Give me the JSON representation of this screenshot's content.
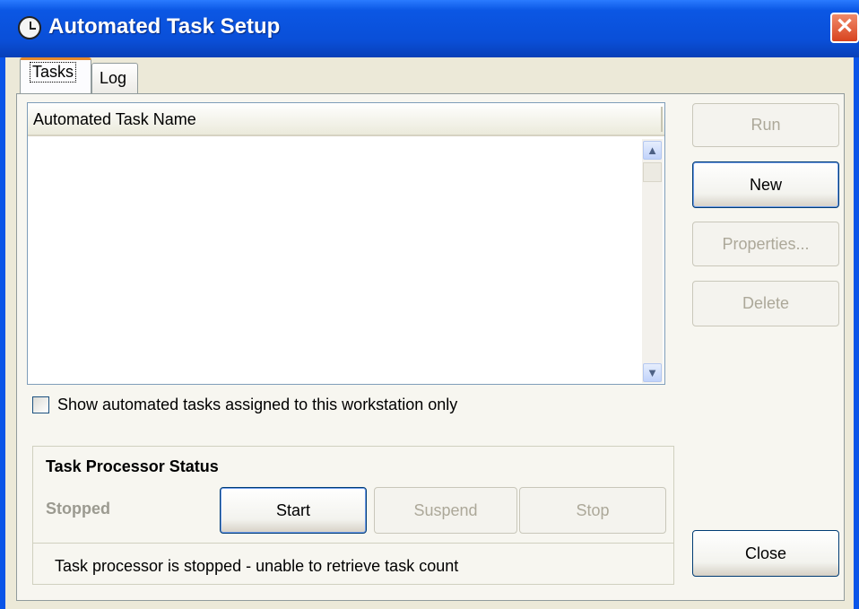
{
  "window": {
    "title": "Automated Task Setup",
    "close_glyph": "✕",
    "icon": "clock-icon"
  },
  "tabs": [
    {
      "label": "Tasks",
      "active": true
    },
    {
      "label": "Log",
      "active": false
    }
  ],
  "list": {
    "column_header": "Automated Task Name",
    "rows": []
  },
  "side_buttons": {
    "run": {
      "label": "Run",
      "enabled": false
    },
    "new": {
      "label": "New",
      "enabled": true
    },
    "properties": {
      "label": "Properties...",
      "enabled": false
    },
    "delete": {
      "label": "Delete",
      "enabled": false
    },
    "close": {
      "label": "Close",
      "enabled": true
    }
  },
  "filter": {
    "checkbox_label": "Show automated tasks assigned to this workstation only",
    "checked": false
  },
  "processor": {
    "group_title": "Task Processor Status",
    "status": "Stopped",
    "start_label": "Start",
    "suspend_label": "Suspend",
    "stop_label": "Stop",
    "message": "Task processor is stopped - unable to retrieve task count"
  },
  "colors": {
    "titlebar": "#0a4fd8",
    "dialog_bg": "#ece9d8",
    "close_button": "#d8431e",
    "active_tab_accent": "#e68b2c"
  }
}
